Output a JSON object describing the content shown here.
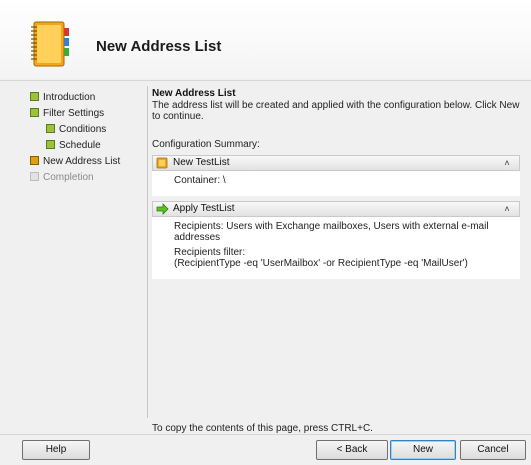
{
  "window": {
    "title": "New Address List"
  },
  "nav": {
    "items": [
      {
        "label": "Introduction"
      },
      {
        "label": "Filter Settings"
      },
      {
        "label": "Conditions"
      },
      {
        "label": "Schedule"
      },
      {
        "label": "New Address List"
      },
      {
        "label": "Completion"
      }
    ]
  },
  "content": {
    "title": "New Address List",
    "description": "The address list will be created and applied with the configuration below. Click New to continue.",
    "summary_label": "Configuration Summary:",
    "sections": [
      {
        "title": "New TestList",
        "icon": "address-list-icon",
        "lines": [
          "Container: \\"
        ]
      },
      {
        "title": "Apply TestList",
        "icon": "green-arrow-icon",
        "lines": [
          "Recipients: Users with Exchange mailboxes, Users with external e-mail addresses",
          "Recipients filter:",
          "(RecipientType -eq 'UserMailbox' -or RecipientType -eq 'MailUser')"
        ]
      }
    ]
  },
  "footer": {
    "note": "To copy the contents of this page, press CTRL+C."
  },
  "buttons": {
    "help": "Help",
    "back": "< Back",
    "new": "New",
    "cancel": "Cancel"
  },
  "colors": {
    "step_done": "#9bc23a",
    "step_current": "#e0a010",
    "step_pending": "#e2e2e2"
  }
}
